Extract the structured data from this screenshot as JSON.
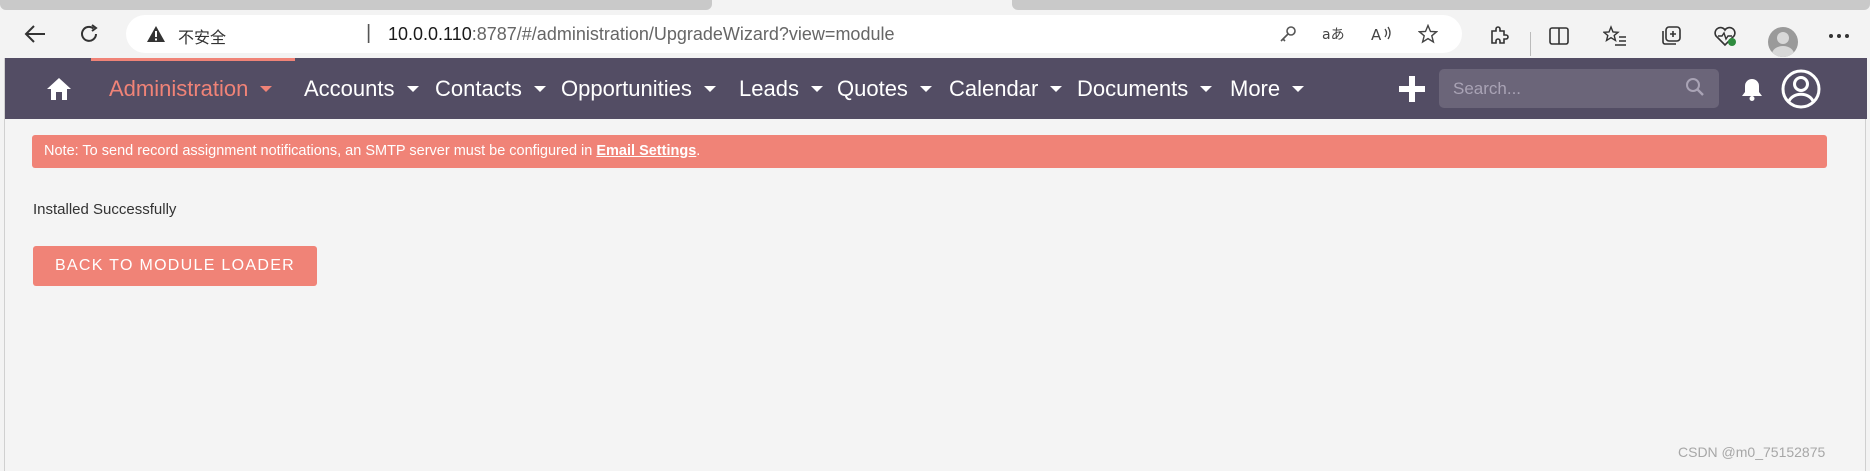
{
  "browser": {
    "security_label": "不安全",
    "address_separator": "|",
    "url_host": "10.0.0.110",
    "url_rest": ":8787/#/administration/UpgradeWizard?view=module"
  },
  "navbar": {
    "items": [
      {
        "label": "Administration",
        "active": true
      },
      {
        "label": "Accounts"
      },
      {
        "label": "Contacts"
      },
      {
        "label": "Opportunities"
      },
      {
        "label": "Leads"
      },
      {
        "label": "Quotes"
      },
      {
        "label": "Calendar"
      },
      {
        "label": "Documents"
      },
      {
        "label": "More"
      }
    ],
    "search_placeholder": "Search...",
    "colors": {
      "bar": "#534d64",
      "accent": "#f08377"
    }
  },
  "notice": {
    "text": "Note: To send record assignment notifications, an SMTP server must be configured in ",
    "link": "Email Settings",
    "suffix": "."
  },
  "main": {
    "status": "Installed Successfully",
    "back_button": "BACK TO MODULE LOADER"
  },
  "watermark": "CSDN @m0_75152875"
}
